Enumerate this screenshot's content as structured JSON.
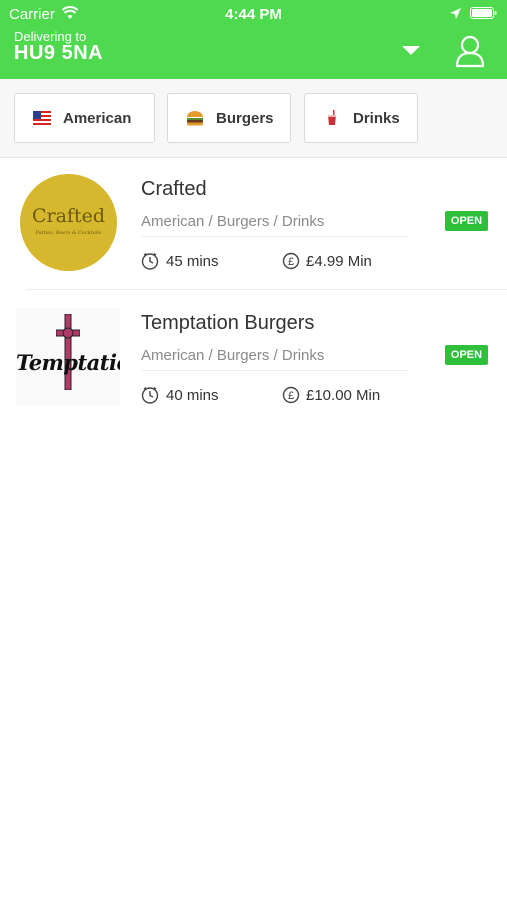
{
  "status_bar": {
    "carrier": "Carrier",
    "time": "4:44 PM"
  },
  "header": {
    "deliver_label": "Delivering to",
    "postcode": "HU9 5NA"
  },
  "filters": [
    {
      "label": "American",
      "icon": "us-flag-icon"
    },
    {
      "label": "Burgers",
      "icon": "burger-icon"
    },
    {
      "label": "Drinks",
      "icon": "drink-icon"
    }
  ],
  "restaurants": [
    {
      "name": "Crafted",
      "cuisines": "American / Burgers / Drinks",
      "status": "OPEN",
      "delivery_time": "45 mins",
      "min_order": "£4.99 Min",
      "logo_text": "Crafted",
      "logo_subtext": "Patties, Beers & Cocktails"
    },
    {
      "name": "Temptation Burgers",
      "cuisines": "American / Burgers / Drinks",
      "status": "OPEN",
      "delivery_time": "40 mins",
      "min_order": "£10.00 Min",
      "logo_text": "Temptation"
    }
  ],
  "colors": {
    "accent": "#4fd94f",
    "open_badge": "#2fbf3a"
  }
}
